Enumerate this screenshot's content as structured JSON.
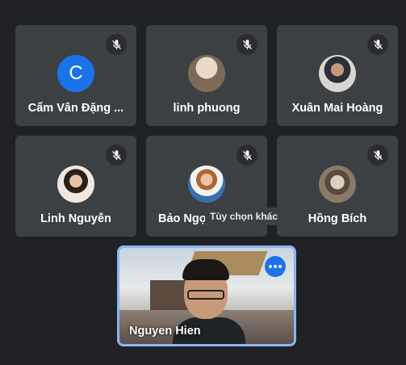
{
  "participants": [
    {
      "name": "Cẩm Vân Đặng ...",
      "avatar_letter": "C",
      "avatar_type": "letter"
    },
    {
      "name": "linh phuong",
      "avatar_type": "photo",
      "avatar_colors": [
        "#7d6a55",
        "#e8dcc8"
      ]
    },
    {
      "name": "Xuân Mai Hoàng",
      "avatar_type": "photo",
      "avatar_colors": [
        "#d8d4d0",
        "#2b2f3a"
      ]
    },
    {
      "name": "Linh Nguyễn",
      "avatar_type": "photo",
      "avatar_colors": [
        "#efe8e2",
        "#2b1f1a"
      ]
    },
    {
      "name": "Bảo Ngọc",
      "avatar_type": "photo",
      "avatar_colors": [
        "#f2f2f2",
        "#3a6fb0"
      ]
    },
    {
      "name": "Hồng Bích",
      "avatar_type": "photo",
      "avatar_colors": [
        "#8a7a6a",
        "#d9cfc5"
      ]
    }
  ],
  "tooltip": "Tùy chọn khác",
  "self_view": {
    "name": "Nguyen Hien",
    "more_icon": "more-options-icon"
  },
  "colors": {
    "background": "#202124",
    "tile": "#3c4043",
    "accent": "#1a73e8",
    "self_border": "#8ab4f8"
  }
}
